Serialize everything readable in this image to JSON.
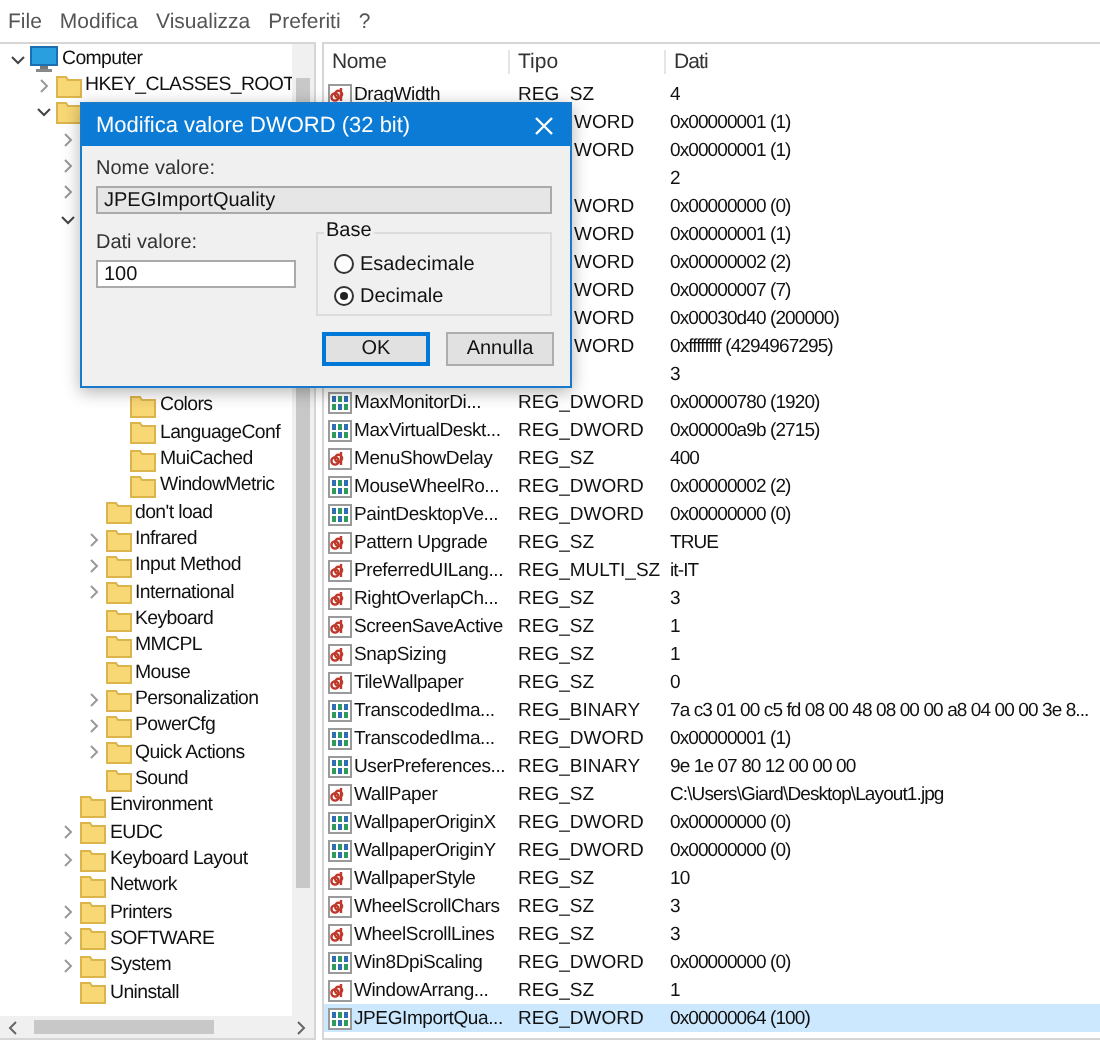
{
  "menu": [
    "File",
    "Modifica",
    "Visualizza",
    "Preferiti",
    "?"
  ],
  "tree": {
    "label": "Computer",
    "expanded": true,
    "children": [
      {
        "label": "HKEY_CLASSES_ROOT",
        "expanded": false
      },
      {
        "expanded": true,
        "children": [
          {
            "expanded": false
          },
          {
            "expanded": false
          },
          {
            "expanded": false
          },
          {
            "expanded": true,
            "children": [
              {
                "kind": "covered"
              },
              {
                "kind": "covered"
              },
              {
                "kind": "covered"
              },
              {
                "kind": "covered"
              },
              {
                "kind": "covered"
              },
              {
                "kind": "covered",
                "children": [
                  {
                    "label": "Colors"
                  },
                  {
                    "label": "LanguageConf"
                  },
                  {
                    "label": "MuiCached"
                  },
                  {
                    "label": "WindowMetric"
                  }
                ]
              },
              {
                "label": "don't load"
              },
              {
                "label": "Infrared",
                "expanded": false
              },
              {
                "label": "Input Method",
                "expanded": false
              },
              {
                "label": "International",
                "expanded": false
              },
              {
                "label": "Keyboard"
              },
              {
                "label": "MMCPL"
              },
              {
                "label": "Mouse"
              },
              {
                "label": "Personalization",
                "expanded": false
              },
              {
                "label": "PowerCfg",
                "expanded": false
              },
              {
                "label": "Quick Actions",
                "expanded": false
              },
              {
                "label": "Sound"
              }
            ]
          },
          {
            "label": "Environment"
          },
          {
            "label": "EUDC",
            "expanded": false
          },
          {
            "label": "Keyboard Layout",
            "expanded": false
          },
          {
            "label": "Network"
          },
          {
            "label": "Printers",
            "expanded": false
          },
          {
            "label": "SOFTWARE",
            "expanded": false
          },
          {
            "label": "System",
            "expanded": false
          },
          {
            "label": "Uninstall"
          }
        ]
      }
    ]
  },
  "table": {
    "columns": [
      "Nome",
      "Tipo",
      "Dati"
    ],
    "rows": [
      {
        "kind": "sz",
        "name": "DragWidth",
        "type": "REG_SZ",
        "data": "4",
        "selected": false
      },
      {
        "type": "WORD",
        "data": "0x00000001 (1)",
        "selected": false
      },
      {
        "type": "WORD",
        "data": "0x00000001 (1)",
        "selected": false
      },
      {
        "data": "2",
        "selected": false
      },
      {
        "type": "WORD",
        "data": "0x00000000 (0)",
        "selected": false
      },
      {
        "type": "WORD",
        "data": "0x00000001 (1)",
        "selected": false
      },
      {
        "type": "WORD",
        "data": "0x00000002 (2)",
        "selected": false
      },
      {
        "type": "WORD",
        "data": "0x00000007 (7)",
        "selected": false
      },
      {
        "type": "WORD",
        "data": "0x00030d40 (200000)",
        "selected": false
      },
      {
        "type": "WORD",
        "data": "0xffffffff (4294967295)",
        "selected": false
      },
      {
        "data": "3",
        "selected": false
      },
      {
        "kind": "bin",
        "name": "MaxMonitorDi...",
        "type": "REG_DWORD",
        "data": "0x00000780 (1920)",
        "selected": false
      },
      {
        "kind": "bin",
        "name": "MaxVirtualDeskt...",
        "type": "REG_DWORD",
        "data": "0x00000a9b (2715)",
        "selected": false
      },
      {
        "kind": "sz",
        "name": "MenuShowDelay",
        "type": "REG_SZ",
        "data": "400",
        "selected": false
      },
      {
        "kind": "bin",
        "name": "MouseWheelRo...",
        "type": "REG_DWORD",
        "data": "0x00000002 (2)",
        "selected": false
      },
      {
        "kind": "bin",
        "name": "PaintDesktopVe...",
        "type": "REG_DWORD",
        "data": "0x00000000 (0)",
        "selected": false
      },
      {
        "kind": "sz",
        "name": "Pattern Upgrade",
        "type": "REG_SZ",
        "data": "TRUE",
        "selected": false
      },
      {
        "kind": "sz",
        "name": "PreferredUILang...",
        "type": "REG_MULTI_SZ",
        "data": "it-IT",
        "selected": false
      },
      {
        "kind": "sz",
        "name": "RightOverlapCh...",
        "type": "REG_SZ",
        "data": "3",
        "selected": false
      },
      {
        "kind": "sz",
        "name": "ScreenSaveActive",
        "type": "REG_SZ",
        "data": "1",
        "selected": false
      },
      {
        "kind": "sz",
        "name": "SnapSizing",
        "type": "REG_SZ",
        "data": "1",
        "selected": false
      },
      {
        "kind": "sz",
        "name": "TileWallpaper",
        "type": "REG_SZ",
        "data": "0",
        "selected": false
      },
      {
        "kind": "bin",
        "name": "TranscodedIma...",
        "type": "REG_BINARY",
        "data": "7a c3 01 00 c5 fd 08 00 48 08 00 00 a8 04 00 00 3e 8...",
        "selected": false
      },
      {
        "kind": "bin",
        "name": "TranscodedIma...",
        "type": "REG_DWORD",
        "data": "0x00000001 (1)",
        "selected": false
      },
      {
        "kind": "bin",
        "name": "UserPreferences...",
        "type": "REG_BINARY",
        "data": "9e 1e 07 80 12 00 00 00",
        "selected": false
      },
      {
        "kind": "sz",
        "name": "WallPaper",
        "type": "REG_SZ",
        "data": "C:\\Users\\Giard\\Desktop\\Layout1.jpg",
        "selected": false
      },
      {
        "kind": "bin",
        "name": "WallpaperOriginX",
        "type": "REG_DWORD",
        "data": "0x00000000 (0)",
        "selected": false
      },
      {
        "kind": "bin",
        "name": "WallpaperOriginY",
        "type": "REG_DWORD",
        "data": "0x00000000 (0)",
        "selected": false
      },
      {
        "kind": "sz",
        "name": "WallpaperStyle",
        "type": "REG_SZ",
        "data": "10",
        "selected": false
      },
      {
        "kind": "sz",
        "name": "WheelScrollChars",
        "type": "REG_SZ",
        "data": "3",
        "selected": false
      },
      {
        "kind": "sz",
        "name": "WheelScrollLines",
        "type": "REG_SZ",
        "data": "3",
        "selected": false
      },
      {
        "kind": "bin",
        "name": "Win8DpiScaling",
        "type": "REG_DWORD",
        "data": "0x00000000 (0)",
        "selected": false
      },
      {
        "kind": "sz",
        "name": "WindowArrang...",
        "type": "REG_SZ",
        "data": "1",
        "selected": false
      },
      {
        "kind": "bin",
        "name": "JPEGImportQua...",
        "type": "REG_DWORD",
        "data": "0x00000064 (100)",
        "selected": true
      }
    ]
  },
  "dialog": {
    "title": "Modifica valore DWORD (32 bit)",
    "name_label": "Nome valore:",
    "name_value": "JPEGImportQuality",
    "data_label": "Dati valore:",
    "data_value": "100",
    "base_label": "Base",
    "bases": [
      {
        "label": "Esadecimale",
        "selected": false
      },
      {
        "label": "Decimale",
        "selected": true
      }
    ],
    "buttons": [
      {
        "label": "OK",
        "focused": true
      },
      {
        "label": "Annulla",
        "focused": false
      }
    ]
  }
}
